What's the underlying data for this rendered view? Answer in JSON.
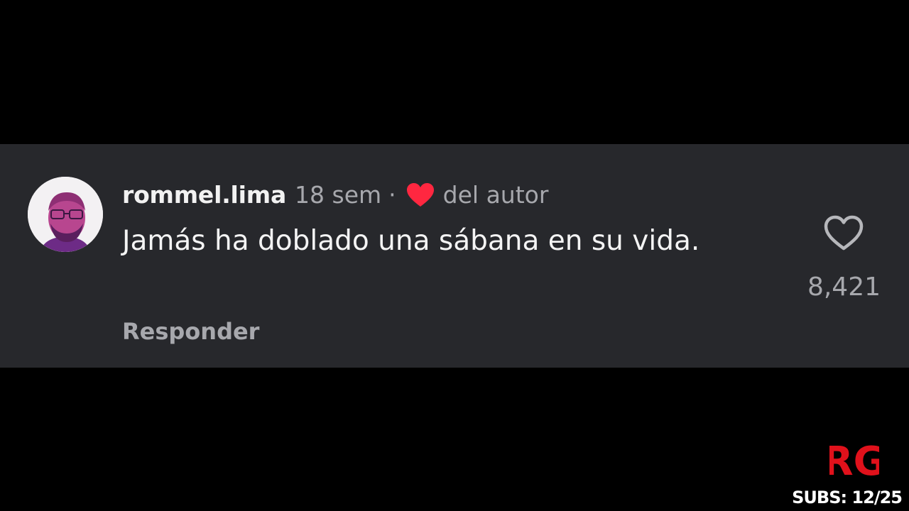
{
  "comment": {
    "username": "rommel.lima",
    "time_ago": "18 sem",
    "separator": "·",
    "author_liked_label": "del autor",
    "text": "Jamás ha doblado una sábana en su vida.",
    "reply_label": "Responder",
    "like_count": "8,421"
  },
  "icons": {
    "avatar": "profile-photo",
    "author_heart": "heart-filled-icon",
    "like": "heart-outline-icon"
  },
  "colors": {
    "author_heart": "#ff2740",
    "panel_background": "#27282c",
    "logo": "#e0111b"
  },
  "watermark": {
    "logo_text": "RG",
    "subs_text": "SUBS: 12/25"
  }
}
